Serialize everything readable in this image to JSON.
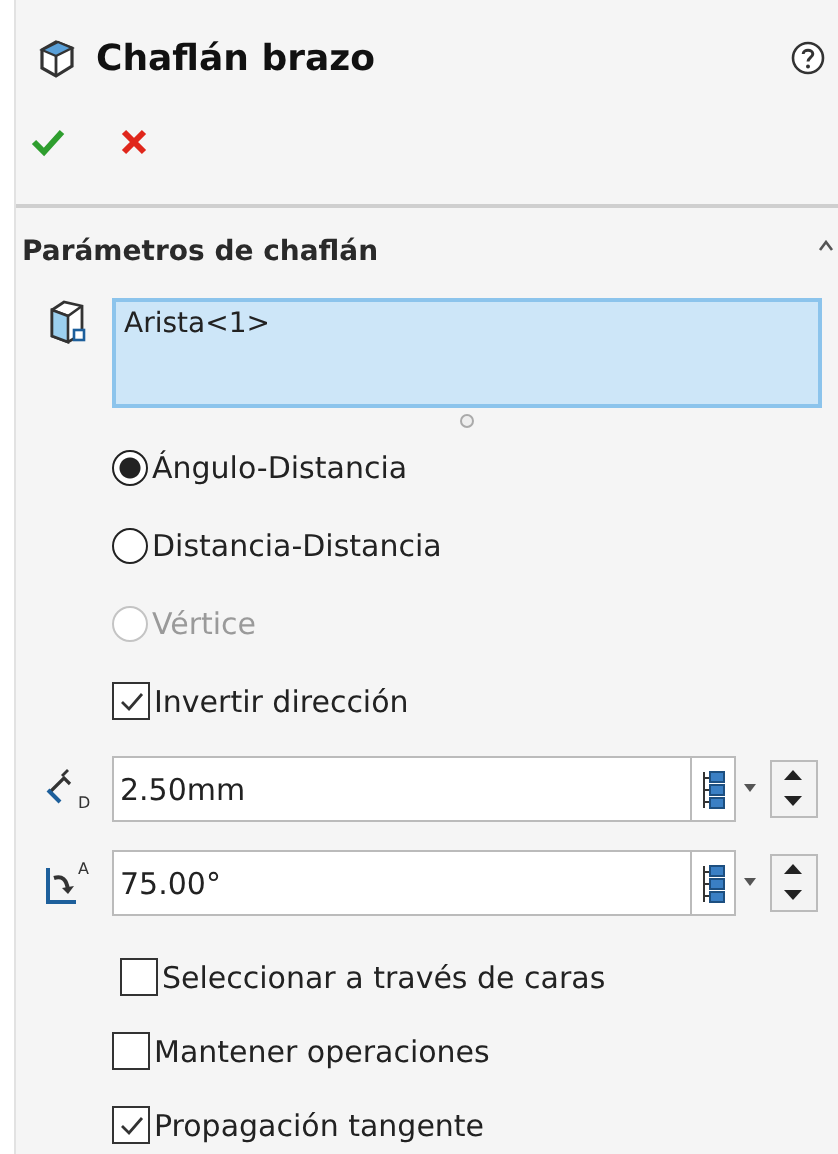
{
  "header": {
    "title": "Chaflán brazo"
  },
  "actions": [
    {
      "kind": "ok"
    },
    {
      "kind": "cancel"
    }
  ],
  "section": {
    "title": "Parámetros de chaflán",
    "expanded": true
  },
  "selection": {
    "value": "Arista<1>"
  },
  "modes": [
    {
      "label": "Ángulo-Distancia",
      "selected": true,
      "disabled": false
    },
    {
      "label": "Distancia-Distancia",
      "selected": false,
      "disabled": false
    },
    {
      "label": "Vértice",
      "selected": false,
      "disabled": true
    }
  ],
  "reverse": {
    "label": "Invertir dirección",
    "checked": true
  },
  "parameters": [
    {
      "kind": "distance",
      "symbol": "D",
      "value": "2.50mm"
    },
    {
      "kind": "angle",
      "symbol": "A",
      "value": "75.00°"
    }
  ],
  "options": [
    {
      "label": "Seleccionar a través de caras",
      "checked": false
    },
    {
      "label": "Mantener operaciones",
      "checked": false
    },
    {
      "label": "Propagación tangente",
      "checked": true
    }
  ]
}
